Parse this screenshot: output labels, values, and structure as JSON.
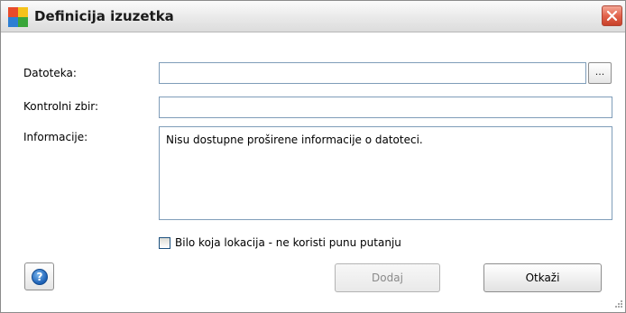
{
  "window": {
    "title": "Definicija izuzetka",
    "icons": {
      "app": "avg-app-icon",
      "close": "close-icon"
    },
    "colors": {
      "close_button": "#d9533b",
      "title_text": "#1a1a1a",
      "field_border": "#7f9db9"
    }
  },
  "form": {
    "file": {
      "label": "Datoteka:",
      "value": "",
      "browse_label": "..."
    },
    "checksum": {
      "label": "Kontrolni zbir:",
      "value": ""
    },
    "info": {
      "label": "Informacije:",
      "value": "Nisu dostupne proširene informacije o datoteci."
    },
    "any_location": {
      "label": "Bilo koja lokacija - ne koristi punu putanju",
      "checked": false
    }
  },
  "buttons": {
    "help_icon": "help-icon",
    "add": "Dodaj",
    "add_enabled": false,
    "cancel": "Otkaži"
  }
}
